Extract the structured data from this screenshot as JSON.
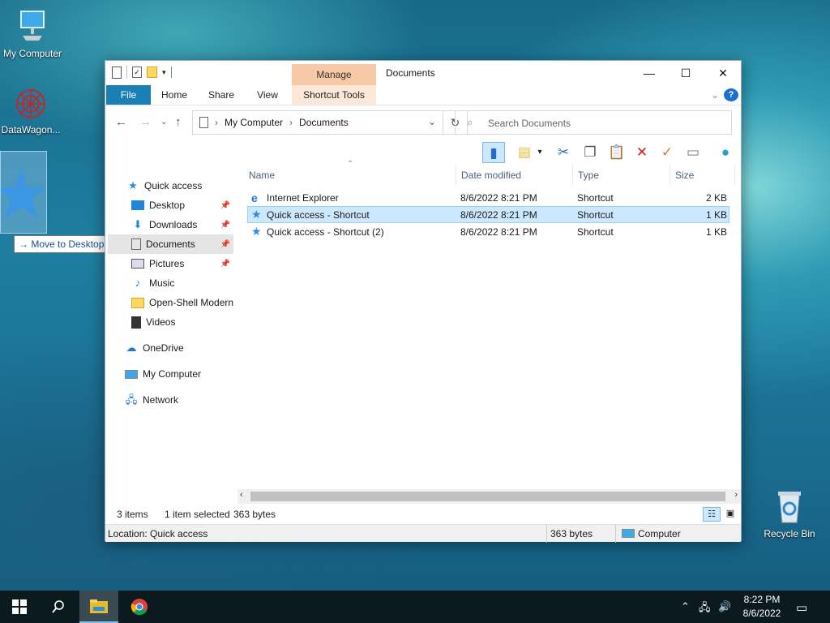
{
  "desktop": {
    "icons": [
      {
        "label": "My Computer"
      },
      {
        "label": "DataWagon..."
      },
      {
        "label": "Recycle Bin"
      }
    ],
    "drag_tooltip": "Move to Desktop"
  },
  "window": {
    "title": "Documents",
    "context_tab_group": "Manage",
    "ribbon_tabs": [
      "File",
      "Home",
      "Share",
      "View",
      "Shortcut Tools"
    ],
    "breadcrumb": [
      "My Computer",
      "Documents"
    ],
    "search_placeholder": "Search Documents",
    "nav": {
      "quick_access": "Quick access",
      "items": [
        "Desktop",
        "Downloads",
        "Documents",
        "Pictures",
        "Music",
        "Open-Shell Modern",
        "Videos"
      ],
      "onedrive": "OneDrive",
      "my_computer": "My Computer",
      "network": "Network"
    },
    "columns": [
      "Name",
      "Date modified",
      "Type",
      "Size"
    ],
    "files": [
      {
        "name": "Internet Explorer",
        "date": "8/6/2022 8:21 PM",
        "type": "Shortcut",
        "size": "2 KB"
      },
      {
        "name": "Quick access - Shortcut",
        "date": "8/6/2022 8:21 PM",
        "type": "Shortcut",
        "size": "1 KB"
      },
      {
        "name": "Quick access - Shortcut (2)",
        "date": "8/6/2022 8:21 PM",
        "type": "Shortcut",
        "size": "1 KB"
      }
    ],
    "status": {
      "items": "3 items",
      "selected": "1 item selected",
      "bytes": "363 bytes"
    },
    "detail_bar": {
      "location": "Location: Quick access",
      "bytes": "363 bytes",
      "computer": "Computer"
    }
  },
  "taskbar": {
    "time": "8:22 PM",
    "date": "8/6/2022"
  },
  "colors": {
    "ribbon_file": "#1a7fb4",
    "manage_tab": "#f7c9a6",
    "selection": "#cce8ff"
  }
}
